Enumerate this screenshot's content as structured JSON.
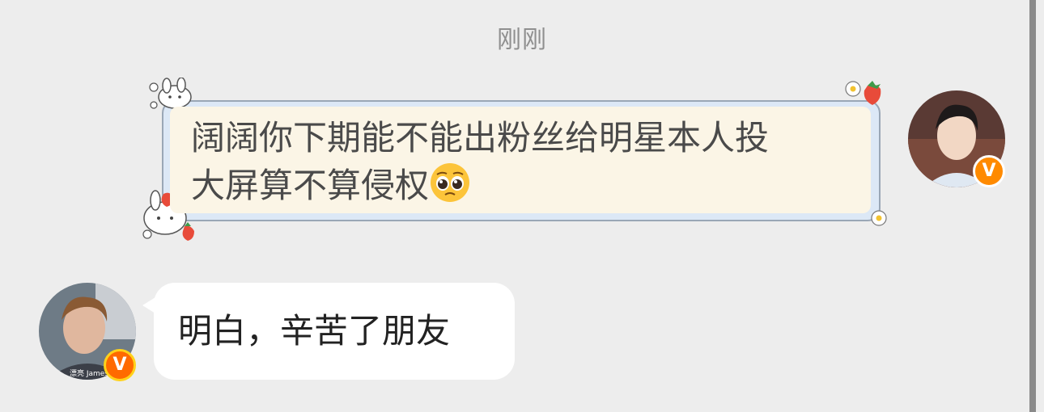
{
  "timestamp": "刚刚",
  "messages": {
    "outgoing": {
      "line1": "阔阔你下期能不能出粉丝给明星本人投",
      "line2": "大屏算不算侵权",
      "emoji": "pleading-face-emoji",
      "badge": "V"
    },
    "incoming": {
      "text": "明白，辛苦了朋友",
      "avatar_caption": "漂亮 James",
      "badge": "V"
    }
  },
  "colors": {
    "background": "#ededed",
    "outgoing_bubble": "#fbf5e6",
    "outgoing_border": "#dce8f6",
    "incoming_bubble": "#ffffff",
    "badge": "#ff8a00"
  }
}
